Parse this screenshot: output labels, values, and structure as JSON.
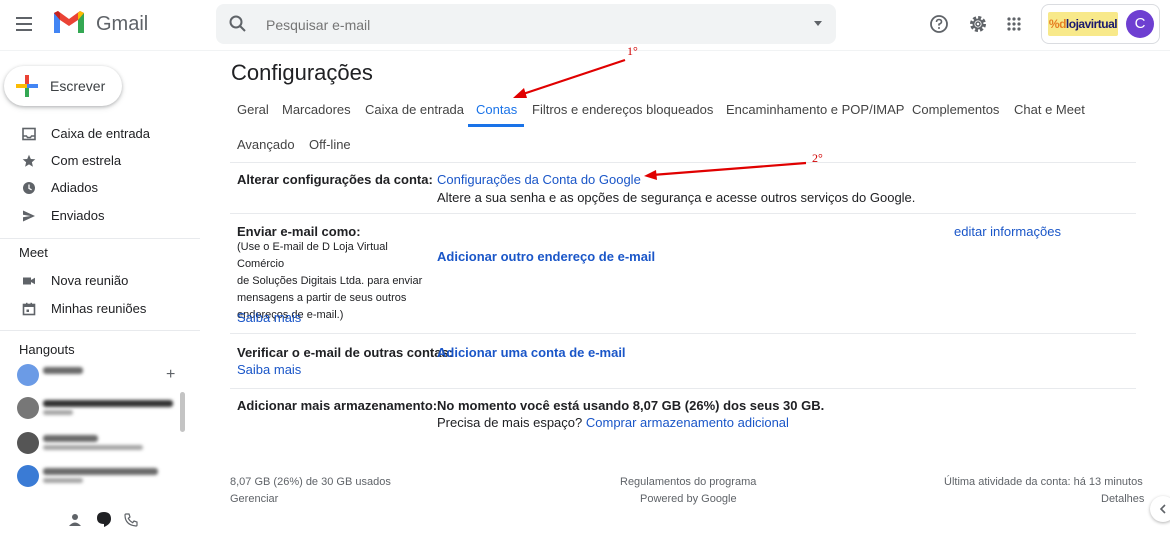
{
  "header": {
    "app_name": "Gmail",
    "search_placeholder": "Pesquisar e-mail",
    "brand_text": "lojavirtual",
    "avatar_letter": "C",
    "icons": [
      "menu-icon",
      "gmail-logo",
      "search-icon",
      "help-icon",
      "gear-icon",
      "apps-grid-icon"
    ]
  },
  "sidebar": {
    "compose_label": "Escrever",
    "items": [
      {
        "label": "Caixa de entrada",
        "icon": "inbox-icon"
      },
      {
        "label": "Com estrela",
        "icon": "star-icon"
      },
      {
        "label": "Adiados",
        "icon": "clock-icon"
      },
      {
        "label": "Enviados",
        "icon": "send-icon"
      }
    ],
    "meet_title": "Meet",
    "meet_items": [
      {
        "label": "Nova reunião",
        "icon": "video-icon"
      },
      {
        "label": "Minhas reuniões",
        "icon": "calendar-icon"
      }
    ],
    "hangouts_title": "Hangouts"
  },
  "main": {
    "title": "Configurações",
    "tabs": [
      {
        "label": "Geral"
      },
      {
        "label": "Marcadores"
      },
      {
        "label": "Caixa de entrada"
      },
      {
        "label": "Contas",
        "active": true
      },
      {
        "label": "Filtros e endereços bloqueados"
      },
      {
        "label": "Encaminhamento e POP/IMAP"
      },
      {
        "label": "Complementos"
      },
      {
        "label": "Chat e Meet"
      },
      {
        "label": "Avançado"
      },
      {
        "label": "Off-line"
      }
    ],
    "rows": {
      "account": {
        "label": "Alterar configurações da conta:",
        "link": "Configurações da Conta do Google",
        "desc": "Altere a sua senha e as opções de segurança e acesse outros serviços do Google."
      },
      "send_as": {
        "label": "Enviar e-mail como:",
        "desc_lines": [
          "(Use o E-mail de D Loja Virtual Comércio",
          "de Soluções Digitais Ltda. para enviar",
          "mensagens a partir de seus outros",
          "endereços de e-mail.)"
        ],
        "learn_more": "Saiba mais",
        "add_link": "Adicionar outro endereço de e-mail",
        "edit_link": "editar informações"
      },
      "check_mail": {
        "label": "Verificar o e-mail de outras contas:",
        "add_link": "Adicionar uma conta de e-mail",
        "learn_more": "Saiba mais"
      },
      "storage": {
        "label": "Adicionar mais armazenamento:",
        "line1": "No momento você está usando 8,07 GB (26%) dos seus 30 GB.",
        "line2_prefix": "Precisa de mais espaço?",
        "line2_link": "Comprar armazenamento adicional"
      }
    },
    "footer": {
      "usage": "8,07 GB (26%) de 30 GB usados",
      "manage": "Gerenciar",
      "policies": "Regulamentos do programa",
      "powered": "Powered by Google",
      "last_activity": "Última atividade da conta: há 13 minutos",
      "details": "Detalhes"
    }
  },
  "annotations": {
    "first": "1°",
    "second": "2°",
    "color": "#e00000"
  },
  "colors": {
    "link": "#1a56c8",
    "active_tab": "#1a73e8",
    "avatar": "#6e3fd1"
  }
}
